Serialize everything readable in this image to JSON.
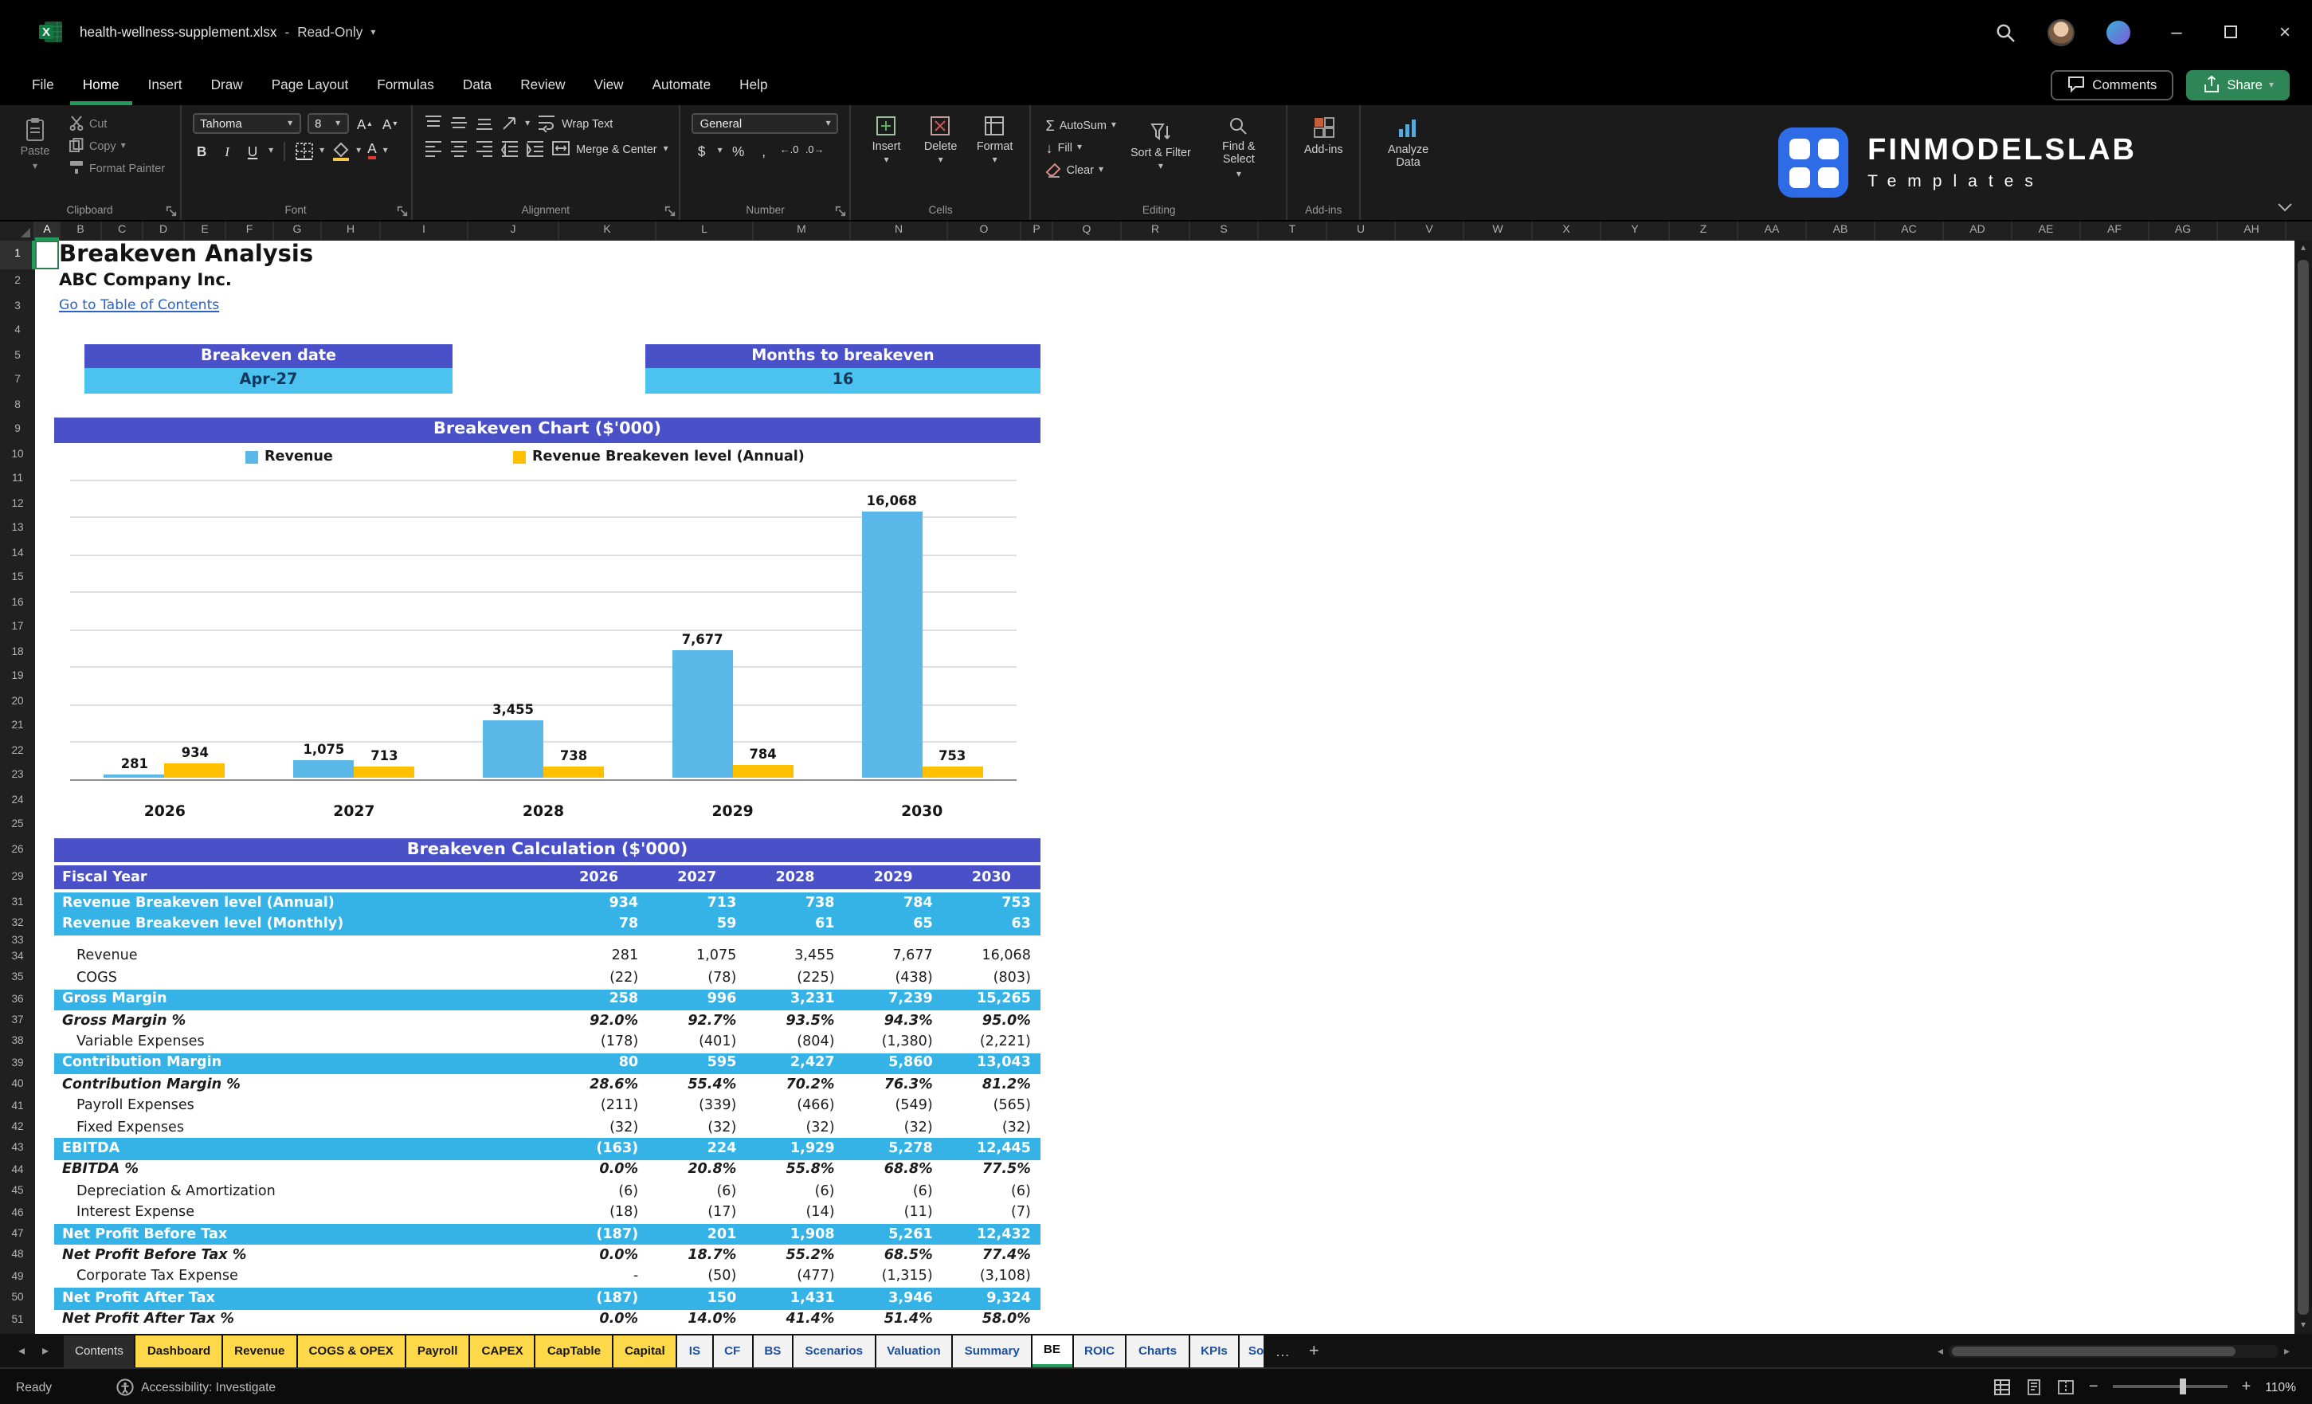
{
  "colors": {
    "purple": "#4950c8",
    "band_blue": "#35b3e7",
    "value_blue": "#4cc2f0",
    "tab_yellow": "#ffd94a",
    "accent_green": "#1f9d5b"
  },
  "window": {
    "filename": "health-wellness-supplement.xlsx",
    "separator": "-",
    "mode": "Read-Only"
  },
  "menu": {
    "items": [
      "File",
      "Home",
      "Insert",
      "Draw",
      "Page Layout",
      "Formulas",
      "Data",
      "Review",
      "View",
      "Automate",
      "Help"
    ],
    "active": "Home",
    "comments": "Comments",
    "share": "Share"
  },
  "ribbon": {
    "clipboard": {
      "group": "Clipboard",
      "paste": "Paste",
      "cut": "Cut",
      "copy": "Copy",
      "format_painter": "Format Painter"
    },
    "font": {
      "group": "Font",
      "family": "Tahoma",
      "size": "8",
      "bold": "B",
      "italic": "I",
      "underline": "U"
    },
    "alignment": {
      "group": "Alignment",
      "wrap": "Wrap Text",
      "merge": "Merge & Center"
    },
    "number": {
      "group": "Number",
      "format": "General",
      "currency": "$",
      "percent": "%",
      "comma": ",",
      "dec_inc": "←.0",
      "dec_dec": ".0→"
    },
    "cells": {
      "group": "Cells",
      "insert": "Insert",
      "delete": "Delete",
      "format": "Format"
    },
    "editing": {
      "group": "Editing",
      "autosum": "AutoSum",
      "fill": "Fill",
      "clear": "Clear",
      "sort": "Sort & Filter",
      "find": "Find & Select"
    },
    "addins": {
      "group": "Add-ins",
      "label": "Add-ins",
      "analyze": "Analyze Data"
    },
    "brand": {
      "name": "FINMODELSLAB",
      "sub": "Templates"
    }
  },
  "grid": {
    "columns": [
      "A",
      "B",
      "C",
      "D",
      "E",
      "F",
      "G",
      "H",
      "I",
      "J",
      "K",
      "L",
      "M",
      "N",
      "O",
      "P",
      "Q",
      "R",
      "S",
      "T",
      "U",
      "V",
      "W",
      "X",
      "Y",
      "Z",
      "AA",
      "AB",
      "AC",
      "AD",
      "AE",
      "AF",
      "AG",
      "AH"
    ],
    "visible_rows": [
      1,
      2,
      3,
      4,
      5,
      7,
      8,
      9,
      10,
      11,
      12,
      13,
      14,
      15,
      16,
      17,
      18,
      19,
      20,
      21,
      22,
      23,
      24,
      25,
      26,
      29,
      31,
      32,
      33,
      34,
      35,
      36,
      37,
      38,
      39,
      40,
      41,
      42,
      43,
      44,
      45,
      46,
      47,
      48,
      49,
      50,
      51
    ]
  },
  "sheet": {
    "title": "Breakeven Analysis",
    "company": "ABC Company Inc.",
    "link": "Go to Table of Contents",
    "kpi_left_label": "Breakeven date",
    "kpi_left_value": "Apr-27",
    "kpi_right_label": "Months to breakeven",
    "kpi_right_value": "16",
    "chart_header": "Breakeven Chart ($'000)",
    "calc_header": "Breakeven Calculation ($'000)"
  },
  "chart_data": {
    "type": "bar",
    "title": "Breakeven Chart ($'000)",
    "categories": [
      "2026",
      "2027",
      "2028",
      "2029",
      "2030"
    ],
    "series": [
      {
        "name": "Revenue",
        "color": "#5ab9e8",
        "values": [
          281,
          1075,
          3455,
          7677,
          16068
        ],
        "labels": [
          "281",
          "1,075",
          "3,455",
          "7,677",
          "16,068"
        ]
      },
      {
        "name": "Revenue Breakeven level (Annual)",
        "color": "#ffc000",
        "values": [
          934,
          713,
          738,
          784,
          753
        ],
        "labels": [
          "934",
          "713",
          "738",
          "784",
          "753"
        ]
      }
    ],
    "ylim": [
      0,
      18000
    ],
    "gridlines": 9,
    "legend_position": "top",
    "grid": true
  },
  "table": {
    "header_label": "Fiscal Year",
    "years": [
      "2026",
      "2027",
      "2028",
      "2029",
      "2030"
    ],
    "rows": [
      {
        "row": 31,
        "style": "band",
        "label": "Revenue Breakeven level (Annual)",
        "values": [
          "934",
          "713",
          "738",
          "784",
          "753"
        ]
      },
      {
        "row": 32,
        "style": "band",
        "label": "Revenue Breakeven level (Monthly)",
        "values": [
          "78",
          "59",
          "61",
          "65",
          "63"
        ]
      },
      {
        "row": 33,
        "style": "spacer",
        "label": "",
        "values": [
          "",
          "",
          "",
          "",
          ""
        ]
      },
      {
        "row": 34,
        "style": "normal",
        "label": "Revenue",
        "values": [
          "281",
          "1,075",
          "3,455",
          "7,677",
          "16,068"
        ]
      },
      {
        "row": 35,
        "style": "normal",
        "label": "COGS",
        "values": [
          "(22)",
          "(78)",
          "(225)",
          "(438)",
          "(803)"
        ]
      },
      {
        "row": 36,
        "style": "band",
        "label": "Gross Margin",
        "values": [
          "258",
          "996",
          "3,231",
          "7,239",
          "15,265"
        ]
      },
      {
        "row": 37,
        "style": "pct",
        "label": "Gross Margin %",
        "values": [
          "92.0%",
          "92.7%",
          "93.5%",
          "94.3%",
          "95.0%"
        ]
      },
      {
        "row": 38,
        "style": "normal",
        "label": "Variable Expenses",
        "values": [
          "(178)",
          "(401)",
          "(804)",
          "(1,380)",
          "(2,221)"
        ]
      },
      {
        "row": 39,
        "style": "band",
        "label": "Contribution Margin",
        "values": [
          "80",
          "595",
          "2,427",
          "5,860",
          "13,043"
        ]
      },
      {
        "row": 40,
        "style": "pct",
        "label": "Contribution Margin %",
        "values": [
          "28.6%",
          "55.4%",
          "70.2%",
          "76.3%",
          "81.2%"
        ]
      },
      {
        "row": 41,
        "style": "normal",
        "label": "Payroll Expenses",
        "values": [
          "(211)",
          "(339)",
          "(466)",
          "(549)",
          "(565)"
        ]
      },
      {
        "row": 42,
        "style": "normal",
        "label": "Fixed Expenses",
        "values": [
          "(32)",
          "(32)",
          "(32)",
          "(32)",
          "(32)"
        ]
      },
      {
        "row": 43,
        "style": "band",
        "label": "EBITDA",
        "values": [
          "(163)",
          "224",
          "1,929",
          "5,278",
          "12,445"
        ]
      },
      {
        "row": 44,
        "style": "pct",
        "label": "EBITDA %",
        "values": [
          "0.0%",
          "20.8%",
          "55.8%",
          "68.8%",
          "77.5%"
        ]
      },
      {
        "row": 45,
        "style": "normal",
        "label": "Depreciation & Amortization",
        "values": [
          "(6)",
          "(6)",
          "(6)",
          "(6)",
          "(6)"
        ]
      },
      {
        "row": 46,
        "style": "normal",
        "label": "Interest Expense",
        "values": [
          "(18)",
          "(17)",
          "(14)",
          "(11)",
          "(7)"
        ]
      },
      {
        "row": 47,
        "style": "band",
        "label": "Net Profit Before Tax",
        "values": [
          "(187)",
          "201",
          "1,908",
          "5,261",
          "12,432"
        ]
      },
      {
        "row": 48,
        "style": "pct",
        "label": "Net Profit Before Tax %",
        "values": [
          "0.0%",
          "18.7%",
          "55.2%",
          "68.5%",
          "77.4%"
        ]
      },
      {
        "row": 49,
        "style": "normal",
        "label": "Corporate Tax Expense",
        "values": [
          "-",
          "(50)",
          "(477)",
          "(1,315)",
          "(3,108)"
        ]
      },
      {
        "row": 50,
        "style": "band",
        "label": "Net Profit After Tax",
        "values": [
          "(187)",
          "150",
          "1,431",
          "3,946",
          "9,324"
        ]
      },
      {
        "row": 51,
        "style": "pct",
        "label": "Net Profit After Tax %",
        "values": [
          "0.0%",
          "14.0%",
          "41.4%",
          "51.4%",
          "58.0%"
        ]
      }
    ]
  },
  "tabs": {
    "items": [
      {
        "label": "Contents",
        "style": "plain"
      },
      {
        "label": "Dashboard",
        "style": "yellow"
      },
      {
        "label": "Revenue",
        "style": "yellow"
      },
      {
        "label": "COGS & OPEX",
        "style": "yellow"
      },
      {
        "label": "Payroll",
        "style": "yellow"
      },
      {
        "label": "CAPEX",
        "style": "yellow"
      },
      {
        "label": "CapTable",
        "style": "yellow"
      },
      {
        "label": "Capital",
        "style": "yellow"
      },
      {
        "label": "IS",
        "style": "white"
      },
      {
        "label": "CF",
        "style": "white"
      },
      {
        "label": "BS",
        "style": "white"
      },
      {
        "label": "Scenarios",
        "style": "white"
      },
      {
        "label": "Valuation",
        "style": "white"
      },
      {
        "label": "Summary",
        "style": "white"
      },
      {
        "label": "BE",
        "style": "active"
      },
      {
        "label": "ROIC",
        "style": "white"
      },
      {
        "label": "Charts",
        "style": "white"
      },
      {
        "label": "KPIs",
        "style": "white"
      },
      {
        "label": "So",
        "style": "white",
        "truncated": true
      }
    ]
  },
  "status": {
    "ready": "Ready",
    "accessibility": "Accessibility: Investigate",
    "zoom": "110%"
  }
}
